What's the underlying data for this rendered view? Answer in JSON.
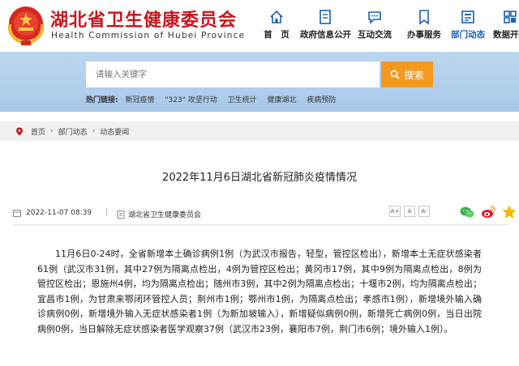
{
  "header": {
    "title": "湖北省卫生健康委员会",
    "subtitle": "Health Commission of Hubei Province",
    "accent_color": "#c8161d"
  },
  "nav": {
    "items": [
      {
        "label": "首　页",
        "icon": "home-icon"
      },
      {
        "label": "政府信息公开",
        "icon": "document-icon"
      },
      {
        "label": "互动交流",
        "icon": "chat-icon"
      },
      {
        "label": "办事服务",
        "icon": "bookmark-icon"
      },
      {
        "label": "部门动态",
        "icon": "news-icon",
        "active": true
      },
      {
        "label": "数据开放",
        "icon": "data-icon"
      }
    ],
    "active_color": "#1a5fb4"
  },
  "search": {
    "placeholder": "请输入关键字",
    "button_label": "搜索",
    "button_color": "#f39a1e"
  },
  "hot": {
    "label": "热门链接:",
    "links": [
      "新冠疫情",
      "\"323\" 攻坚行动",
      "卫生统计",
      "健康湖北",
      "疾病预防"
    ]
  },
  "breadcrumb": [
    "首页",
    "部门动态",
    "动态要闻"
  ],
  "article": {
    "title": "2022年11月6日湖北省新冠肺炎疫情情况",
    "date": "2022-11-07 08:39",
    "source": "湖北省卫生健康委员会",
    "font_sizes": [
      "A+",
      "A",
      "A-"
    ],
    "body": "11月6日0-24时，全省新增本土确诊病例1例（为武汉市报告，轻型，管控区检出），新增本土无症状感染者61例（武汉市31例，其中27例为隔离点检出，4例为管控区检出；黄冈市17例，其中9例为隔离点检出，8例为管控区检出；恩施州4例，均为隔离点检出；随州市3例，其中2例为隔离点检出；十堰市2例，均为隔离点检出；宜昌市1例，为甘肃来鄂闭环管控人员；荆州市1例；鄂州市1例，为隔离点检出；孝感市1例），新增境外输入确诊病例0例，新增境外输入无症状感染者1例（为新加坡输入），新增疑似病例0例，新增死亡病例0例，当日出院病例0例，当日解除无症状感染者医学观察37例（武汉市23例，襄阳市7例，荆门市6例；境外输入1例）。"
  },
  "share_icons": [
    "wechat-icon",
    "weibo-icon",
    "qzone-icon"
  ]
}
